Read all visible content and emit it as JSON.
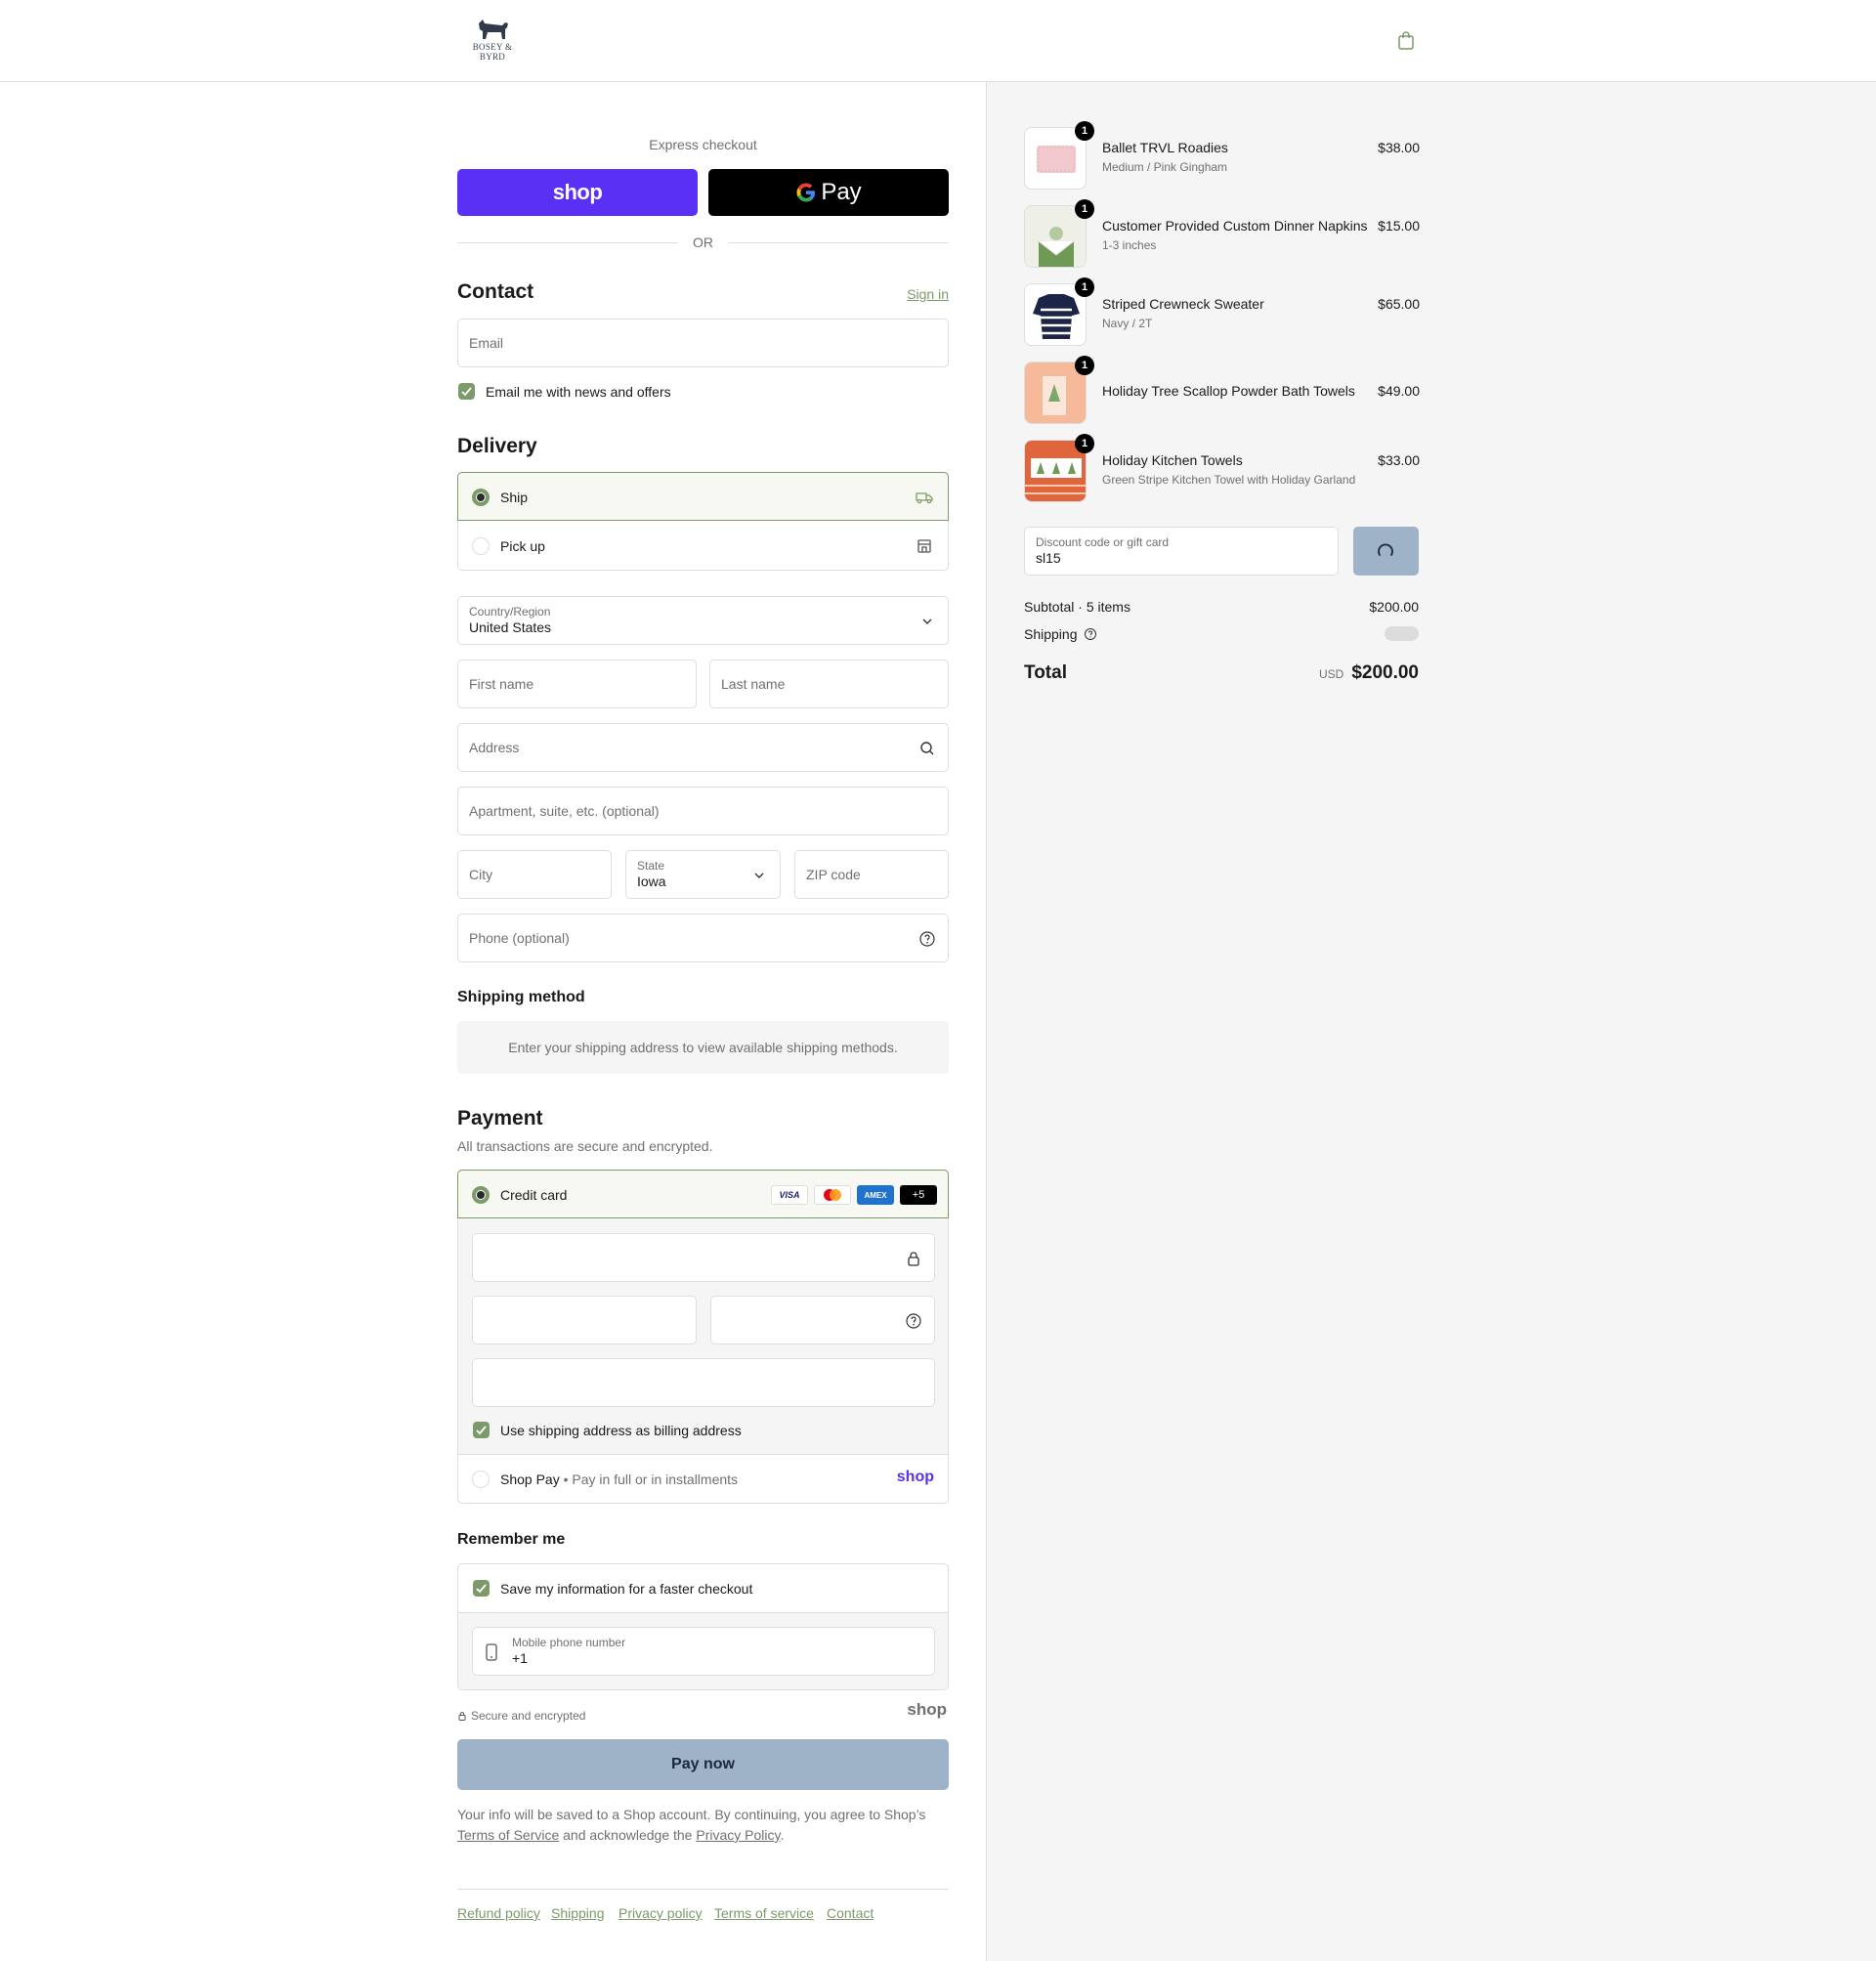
{
  "header": {
    "logo_text": "BOSEY & BYRD"
  },
  "express": {
    "title": "Express checkout",
    "shop_label": "shop",
    "gpay_label": "Pay",
    "or_label": "OR"
  },
  "contact": {
    "title": "Contact",
    "sign_in": "Sign in",
    "email_placeholder": "Email",
    "news_label": "Email me with news and offers"
  },
  "delivery": {
    "title": "Delivery",
    "options": [
      {
        "label": "Ship",
        "selected": true,
        "icon": "truck-icon"
      },
      {
        "label": "Pick up",
        "selected": false,
        "icon": "store-icon"
      }
    ],
    "country_label": "Country/Region",
    "country_value": "United States",
    "first_name": "First name",
    "last_name": "Last name",
    "address": "Address",
    "apartment": "Apartment, suite, etc. (optional)",
    "city": "City",
    "state_label": "State",
    "state_value": "Iowa",
    "zip": "ZIP code",
    "phone": "Phone (optional)"
  },
  "shipping_method": {
    "title": "Shipping method",
    "notice": "Enter your shipping address to view available shipping methods."
  },
  "payment": {
    "title": "Payment",
    "subtitle": "All transactions are secure and encrypted.",
    "credit_card_label": "Credit card",
    "cards": [
      "VISA",
      "MC",
      "AMEX",
      "+5"
    ],
    "billing_label": "Use shipping address as billing address",
    "shop_pay_label": "Shop Pay",
    "shop_pay_desc": "Pay in full or in installments",
    "shop_pay_logo": "shop"
  },
  "remember": {
    "title": "Remember me",
    "save_label": "Save my information for a faster checkout",
    "mobile_label": "Mobile phone number",
    "mobile_value": "+1",
    "secure_label": "Secure and encrypted",
    "shop_logo": "shop"
  },
  "pay_now": "Pay now",
  "legal": {
    "text1": "Your info will be saved to a Shop account. By continuing, you agree to Shop’s",
    "tos": "Terms of Service",
    "text2": "and acknowledge the",
    "privacy": "Privacy Policy",
    "text3": "."
  },
  "footer": {
    "links": [
      "Refund policy",
      "Shipping",
      "Privacy policy",
      "Terms of service",
      "Contact"
    ]
  },
  "cart": {
    "items": [
      {
        "name": "Ballet TRVL Roadies",
        "variant": "Medium / Pink Gingham",
        "price": "$38.00",
        "qty": "1"
      },
      {
        "name": "Customer Provided Custom Dinner Napkins",
        "variant": "1-3 inches",
        "price": "$15.00",
        "qty": "1"
      },
      {
        "name": "Striped Crewneck Sweater",
        "variant": "Navy / 2T",
        "price": "$65.00",
        "qty": "1"
      },
      {
        "name": "Holiday Tree Scallop Powder Bath Towels",
        "variant": "",
        "price": "$49.00",
        "qty": "1"
      },
      {
        "name": "Holiday Kitchen Towels",
        "variant": "Green Stripe Kitchen Towel with Holiday Garland",
        "price": "$33.00",
        "qty": "1"
      }
    ],
    "discount_label": "Discount code or gift card",
    "discount_value": "sl15",
    "subtotal_label": "Subtotal · 5 items",
    "subtotal_value": "$200.00",
    "shipping_label": "Shipping",
    "total_label": "Total",
    "currency": "USD",
    "total_value": "$200.00"
  },
  "colors": {
    "accent": "#7c9a6a",
    "shop_purple": "#5a31f4",
    "pay_button": "#9eb2c8"
  }
}
